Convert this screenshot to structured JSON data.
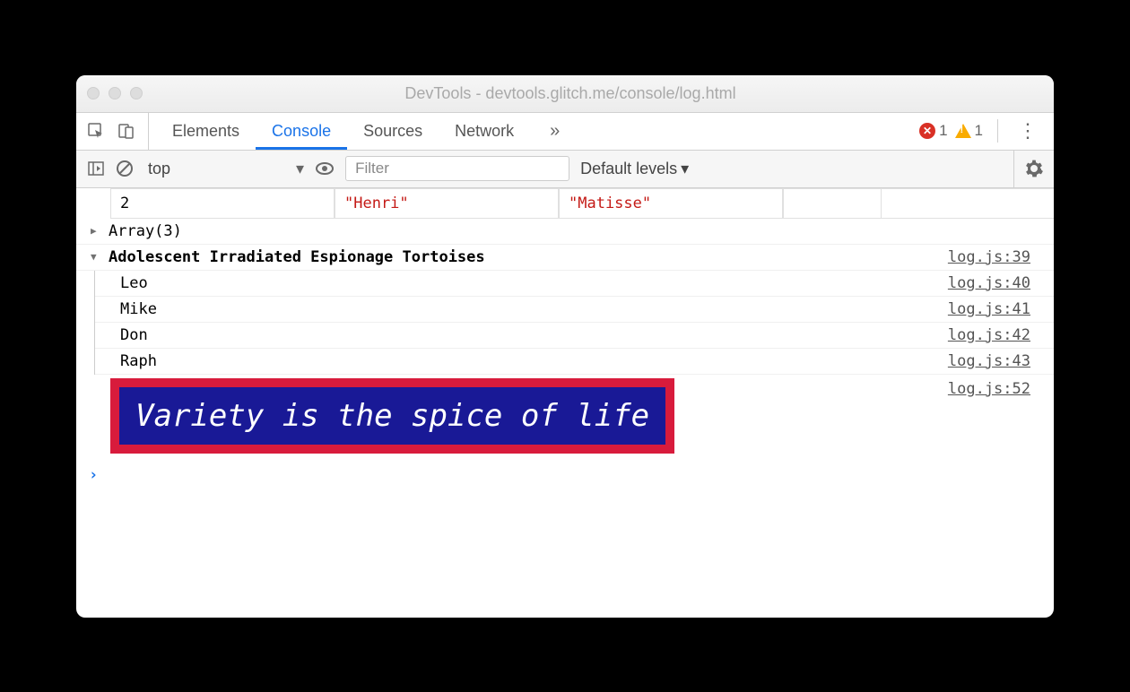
{
  "titlebar": {
    "title": "DevTools - devtools.glitch.me/console/log.html"
  },
  "tabs": {
    "elements": "Elements",
    "console": "Console",
    "sources": "Sources",
    "network": "Network",
    "more": "»"
  },
  "badges": {
    "errors": "1",
    "warnings": "1"
  },
  "toolbar": {
    "context": "top",
    "filter_placeholder": "Filter",
    "levels": "Default levels"
  },
  "table": {
    "index": "2",
    "first": "\"Henri\"",
    "last": "\"Matisse\""
  },
  "array_row": "Array(3)",
  "group": {
    "header": "Adolescent Irradiated Espionage Tortoises",
    "header_src": "log.js:39",
    "items": [
      {
        "text": "Leo",
        "src": "log.js:40"
      },
      {
        "text": "Mike",
        "src": "log.js:41"
      },
      {
        "text": "Don",
        "src": "log.js:42"
      },
      {
        "text": "Raph",
        "src": "log.js:43"
      }
    ]
  },
  "styled": {
    "text": "Variety is the spice of life",
    "src": "log.js:52"
  },
  "prompt": "›"
}
